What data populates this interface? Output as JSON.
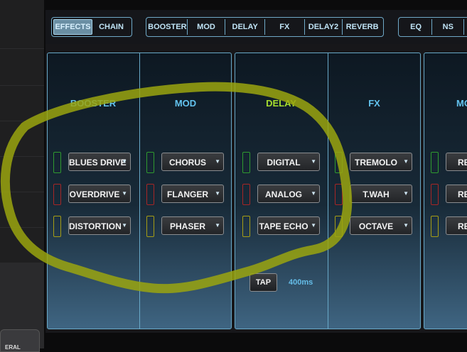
{
  "left_panel": {
    "tab_label": "ERAL"
  },
  "tabs": {
    "view": [
      "EFFECTS",
      "CHAIN"
    ],
    "blocks": [
      "BOOSTER",
      "MOD",
      "DELAY",
      "FX",
      "DELAY2",
      "REVERB"
    ],
    "extra": [
      "EQ",
      "NS",
      ""
    ]
  },
  "columns": [
    {
      "title": "BOOSTER",
      "items": [
        "BLUES DRIVE",
        "OVERDRIVE",
        "DISTORTION"
      ]
    },
    {
      "title": "MOD",
      "items": [
        "CHORUS",
        "FLANGER",
        "PHASER"
      ]
    },
    {
      "title": "DELAY",
      "items": [
        "DIGITAL",
        "ANALOG",
        "TAPE ECHO"
      ]
    },
    {
      "title": "FX",
      "items": [
        "TREMOLO",
        "T.WAH",
        "OCTAVE"
      ]
    },
    {
      "title": "MO",
      "items": [
        "RE",
        "RE",
        "RE"
      ]
    }
  ],
  "tap": {
    "label": "TAP",
    "value": "400ms"
  },
  "colors": {
    "accent": "#63c3ef",
    "delay_title": "#a5dc2f",
    "led_green": "#2f9a2f",
    "led_red": "#a62626",
    "led_yellow": "#a69d14",
    "scribble": "#9aa40f"
  }
}
